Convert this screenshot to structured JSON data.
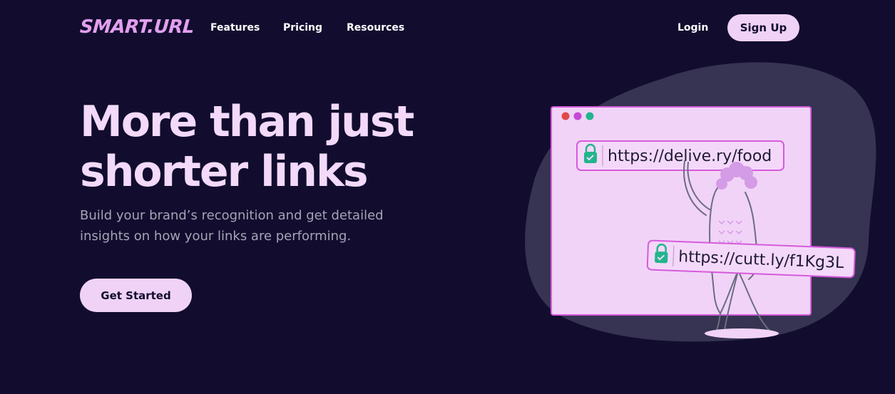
{
  "nav": {
    "logo": "SMART.URL",
    "links": [
      "Features",
      "Pricing",
      "Resources"
    ],
    "login": "Login",
    "signup": "Sign Up"
  },
  "hero": {
    "title_line1": "More than just",
    "title_line2": "shorter links",
    "subtitle_line1": "Build your brand’s recognition and get detailed",
    "subtitle_line2": "insights on how your links are performing.",
    "cta": "Get Started"
  },
  "illustration": {
    "url_long": "https://delive.ry/food",
    "url_short": "https://cutt.ly/f1Kg3L",
    "lock_icon": "lock-icon",
    "window_dots": [
      "#e04848",
      "#c34ad6",
      "#22b58c"
    ]
  },
  "colors": {
    "background": "#120d2e",
    "accent_pink": "#e29fef",
    "button_bg": "#f0d2f7",
    "title": "#f3d9fa",
    "subtitle": "#a6a3b6",
    "blob": "#363452",
    "window": "#f1d3f8",
    "window_border": "#d65bdb",
    "lock_green": "#22b58c"
  }
}
